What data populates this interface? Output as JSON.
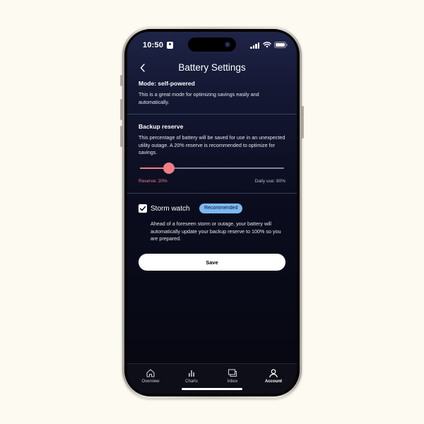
{
  "status_bar": {
    "time": "10:50",
    "icons": [
      "id-card-icon",
      "signal-icon",
      "wifi-icon",
      "battery-icon"
    ]
  },
  "header": {
    "title": "Battery Settings",
    "back_icon": "chevron-left-icon"
  },
  "mode": {
    "title": "Mode: self-powered",
    "description": "This is a great mode for optimizing savings easily and automatically."
  },
  "backup_reserve": {
    "title": "Backup reserve",
    "description": "This percentage of battery will be saved for use in an unexpected utility outage. A 20% reserve is recommended to optimize for savings.",
    "reserve_percent": 20,
    "reserve_label": "Reserve: 20%",
    "daily_use_label": "Daily use: 80%"
  },
  "storm_watch": {
    "checked": true,
    "label": "Storm watch",
    "badge": "Recommended",
    "description": "Ahead of a foreseen storm or outage, your battery will automatically update your backup reserve to 100% so you are prepared."
  },
  "actions": {
    "save_label": "Save"
  },
  "bottom_nav": {
    "items": [
      {
        "label": "Overview",
        "icon": "home-icon",
        "active": false
      },
      {
        "label": "Charts",
        "icon": "bar-chart-icon",
        "active": false
      },
      {
        "label": "Inbox",
        "icon": "inbox-icon",
        "active": false
      },
      {
        "label": "Account",
        "icon": "account-icon",
        "active": true
      }
    ]
  },
  "colors": {
    "accent": "#f07e86",
    "badge": "#7cbaf2",
    "screen_bg": "#0b0d1f",
    "page_bg": "#fcfaf1"
  }
}
